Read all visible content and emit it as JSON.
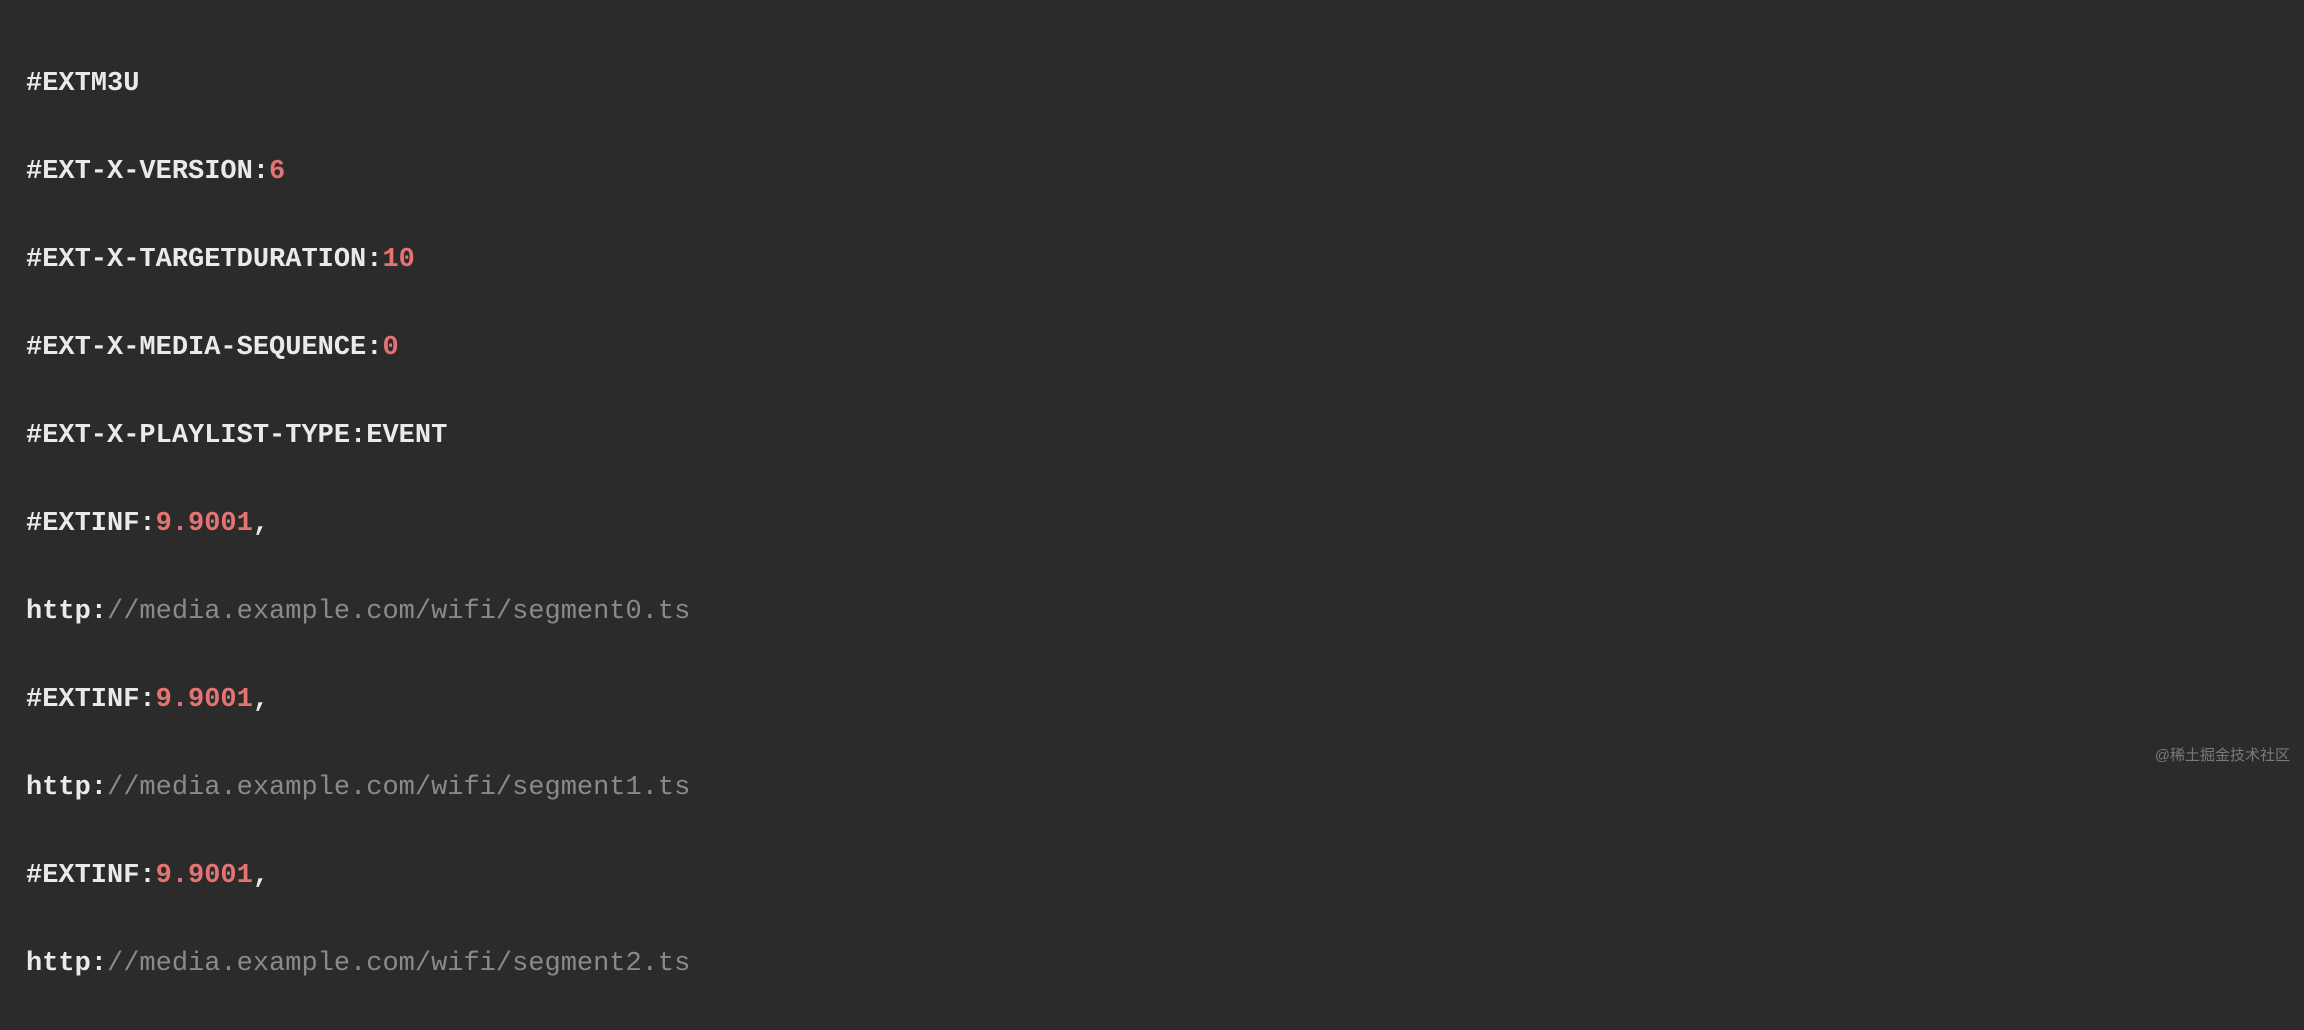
{
  "playlist": {
    "header": "#EXTM3U",
    "version_tag": "#EXT-X-VERSION:",
    "version_value": "6",
    "targetduration_tag": "#EXT-X-TARGETDURATION:",
    "targetduration_value": "10",
    "mediasequence_tag": "#EXT-X-MEDIA-SEQUENCE:",
    "mediasequence_value": "0",
    "playlisttype_tag": "#EXT-X-PLAYLIST-TYPE:EVENT",
    "segments": [
      {
        "extinf_tag": "#EXTINF:",
        "extinf_value": "9.9001",
        "comma": ",",
        "url_scheme": "http:",
        "url_rest": "//media.example.com/wifi/segment0.ts"
      },
      {
        "extinf_tag": "#EXTINF:",
        "extinf_value": "9.9001",
        "comma": ",",
        "url_scheme": "http:",
        "url_rest": "//media.example.com/wifi/segment1.ts"
      },
      {
        "extinf_tag": "#EXTINF:",
        "extinf_value": "9.9001",
        "comma": ",",
        "url_scheme": "http:",
        "url_rest": "//media.example.com/wifi/segment2.ts"
      }
    ]
  },
  "watermark": "@稀土掘金技术社区"
}
